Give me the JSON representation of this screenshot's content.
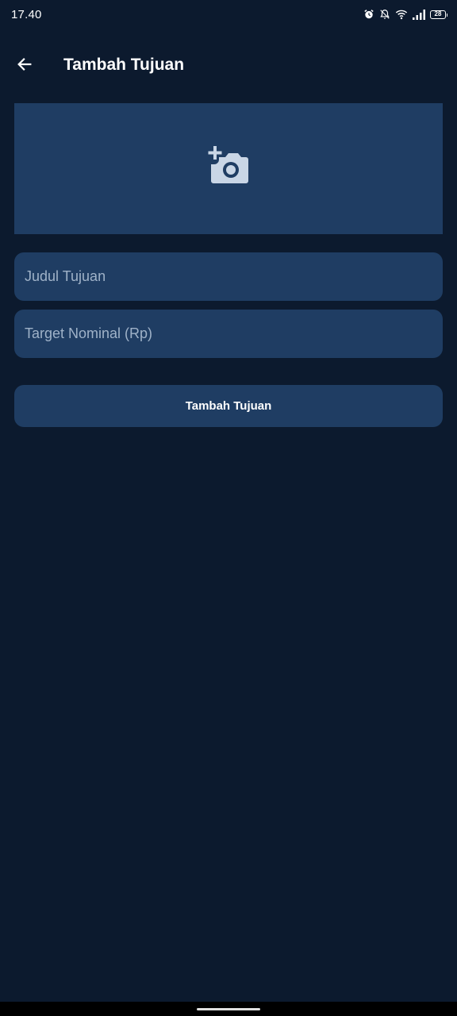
{
  "status_bar": {
    "time": "17.40",
    "battery": "28",
    "icons": [
      "alarm-icon",
      "notifications-off-icon",
      "wifi-icon",
      "signal-icon",
      "battery-icon"
    ]
  },
  "app_bar": {
    "back_icon": "arrow-back-icon",
    "title": "Tambah Tujuan"
  },
  "image_picker": {
    "icon": "add-photo-icon"
  },
  "form": {
    "title_placeholder": "Judul Tujuan",
    "title_value": "",
    "target_placeholder": "Target Nominal (Rp)",
    "target_value": ""
  },
  "submit": {
    "label": "Tambah Tujuan"
  },
  "colors": {
    "background": "#0c1a2e",
    "surface": "#1f3d63",
    "placeholder": "#9fb2c8",
    "icon": "#c9d6e6"
  }
}
